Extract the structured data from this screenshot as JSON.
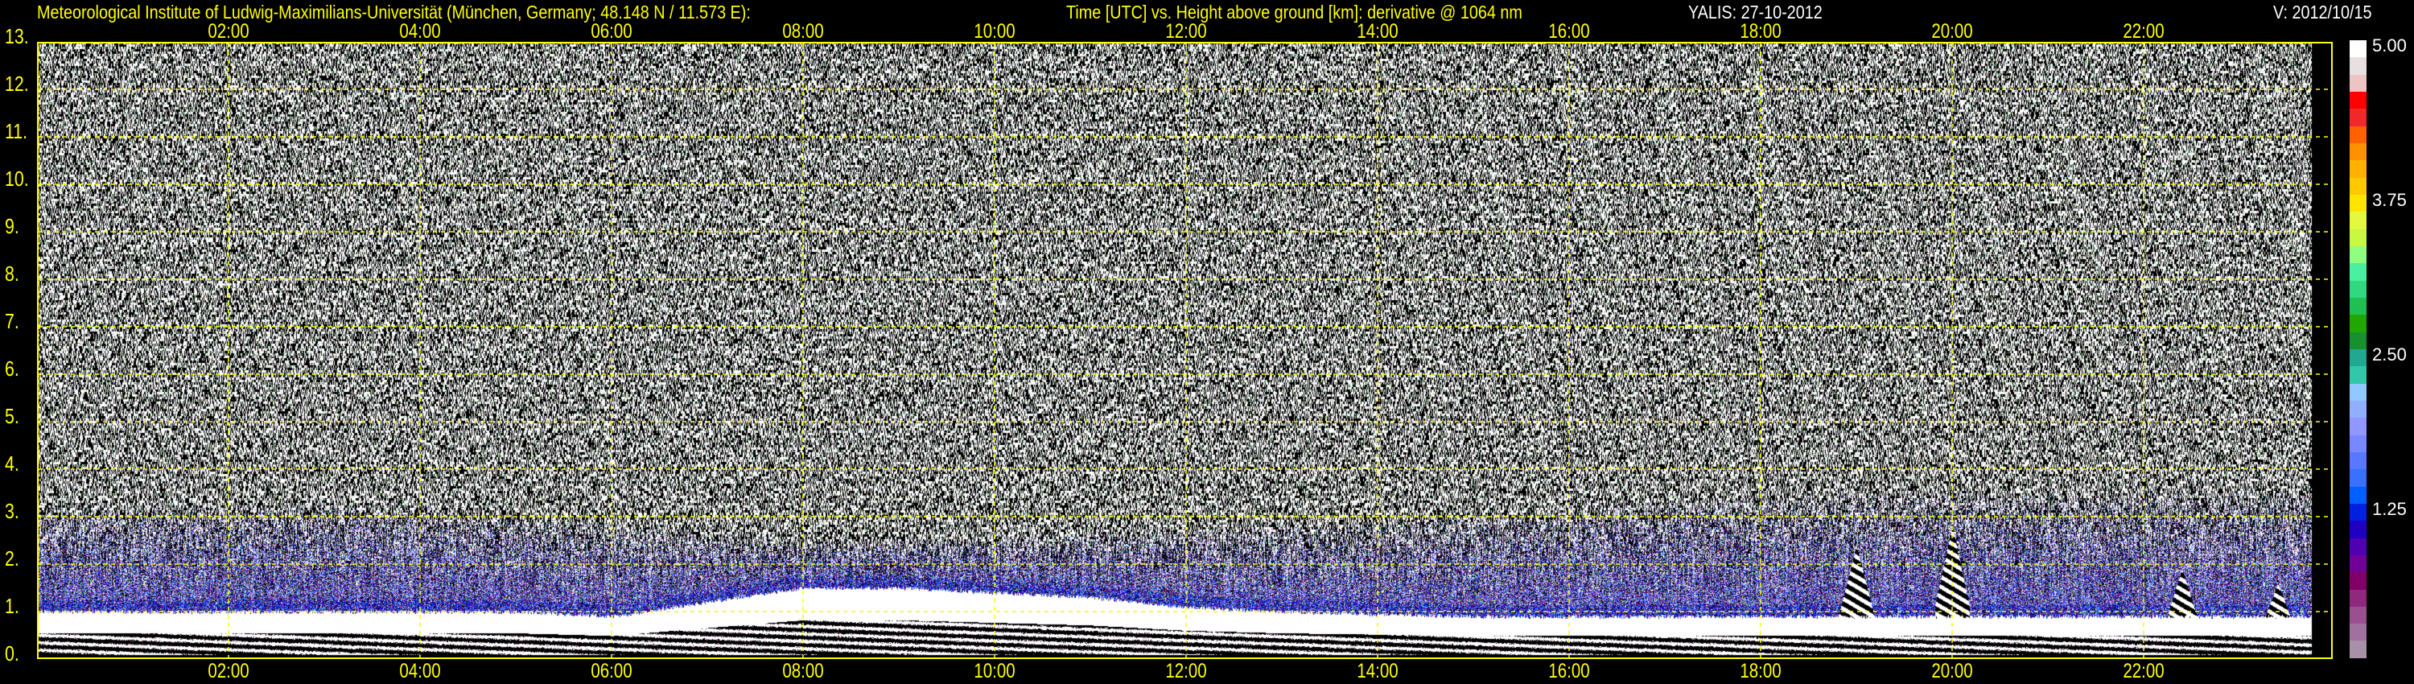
{
  "header": {
    "institute": "Meteorological Institute of Ludwig-Maximilians-Universität (München, Germany; 48.148 N / 11.573 E):",
    "plot_title": "Time [UTC] vs. Height above ground [km]: derivative @ 1064 nm",
    "instrument_date": "YALIS: 27-10-2012",
    "version": "V: 2012/10/15"
  },
  "chart_data": {
    "type": "heatmap",
    "title": "Time [UTC] vs. Height above ground [km]: derivative @ 1064 nm",
    "xlabel": "Time [UTC]",
    "ylabel": "Height above ground [km]",
    "xlim_hours": [
      0,
      24
    ],
    "ylim_km": [
      0,
      13
    ],
    "x_ticks": [
      "02:00",
      "04:00",
      "06:00",
      "08:00",
      "10:00",
      "12:00",
      "14:00",
      "16:00",
      "18:00",
      "20:00",
      "22:00"
    ],
    "x_tick_hours": [
      2,
      4,
      6,
      8,
      10,
      12,
      14,
      16,
      18,
      20,
      22
    ],
    "y_ticks": [
      "0.",
      "1.",
      "2.",
      "3.",
      "4.",
      "5.",
      "6.",
      "7.",
      "8.",
      "9.",
      "10.",
      "11.",
      "12.",
      "13."
    ],
    "y_tick_km": [
      0,
      1,
      2,
      3,
      4,
      5,
      6,
      7,
      8,
      9,
      10,
      11,
      12,
      13
    ],
    "grid": true,
    "grid_color": "#ffff00",
    "colorbar": {
      "range": [
        0,
        5
      ],
      "tick_labels": [
        "5.00",
        "3.75",
        "2.50",
        "1.25"
      ],
      "tick_values": [
        5.0,
        3.75,
        2.5,
        1.25
      ],
      "colors_top_to_bottom": [
        "#ffffff",
        "#e8e0e0",
        "#ecc4c4",
        "#ff0000",
        "#f02828",
        "#ff6000",
        "#ff9000",
        "#ffb000",
        "#ffc800",
        "#ffe400",
        "#e4f840",
        "#c8f840",
        "#90ff80",
        "#48f0a0",
        "#30d880",
        "#20c050",
        "#20a800",
        "#189030",
        "#20a890",
        "#30c8a8",
        "#90c8ff",
        "#90b0ff",
        "#9098ff",
        "#7888ff",
        "#5878ff",
        "#3870ff",
        "#0060ff",
        "#0020e0",
        "#2000c0",
        "#5000b0",
        "#700098",
        "#800068",
        "#902880",
        "#9a5090",
        "#a070a0",
        "#a890a8"
      ]
    },
    "data_end_hour": 23.75,
    "mixing_layer_top_km": {
      "hours": [
        0,
        1,
        2,
        3,
        4,
        5,
        6,
        7,
        8,
        9,
        10,
        11,
        12,
        13,
        14,
        15,
        16,
        17,
        18,
        19,
        20,
        21,
        22,
        23,
        23.75
      ],
      "values": [
        1.0,
        1.0,
        1.0,
        1.0,
        1.0,
        1.0,
        0.9,
        1.2,
        1.5,
        1.5,
        1.4,
        1.3,
        1.1,
        1.0,
        0.95,
        0.9,
        0.9,
        0.9,
        0.9,
        0.9,
        0.9,
        0.9,
        0.9,
        0.9,
        0.9
      ]
    },
    "aerosol_band_top_km": {
      "hours": [
        0,
        4,
        6,
        8,
        10,
        12,
        14,
        16,
        18,
        20,
        22,
        23.75
      ],
      "values": [
        3.0,
        3.0,
        2.6,
        2.2,
        2.3,
        2.5,
        2.6,
        3.0,
        3.2,
        3.3,
        3.3,
        3.3
      ]
    },
    "plumes": [
      {
        "hour": 19.0,
        "top_km": 2.4
      },
      {
        "hour": 20.0,
        "top_km": 2.8
      },
      {
        "hour": 22.4,
        "top_km": 1.9
      },
      {
        "hour": 23.4,
        "top_km": 1.6
      }
    ]
  }
}
